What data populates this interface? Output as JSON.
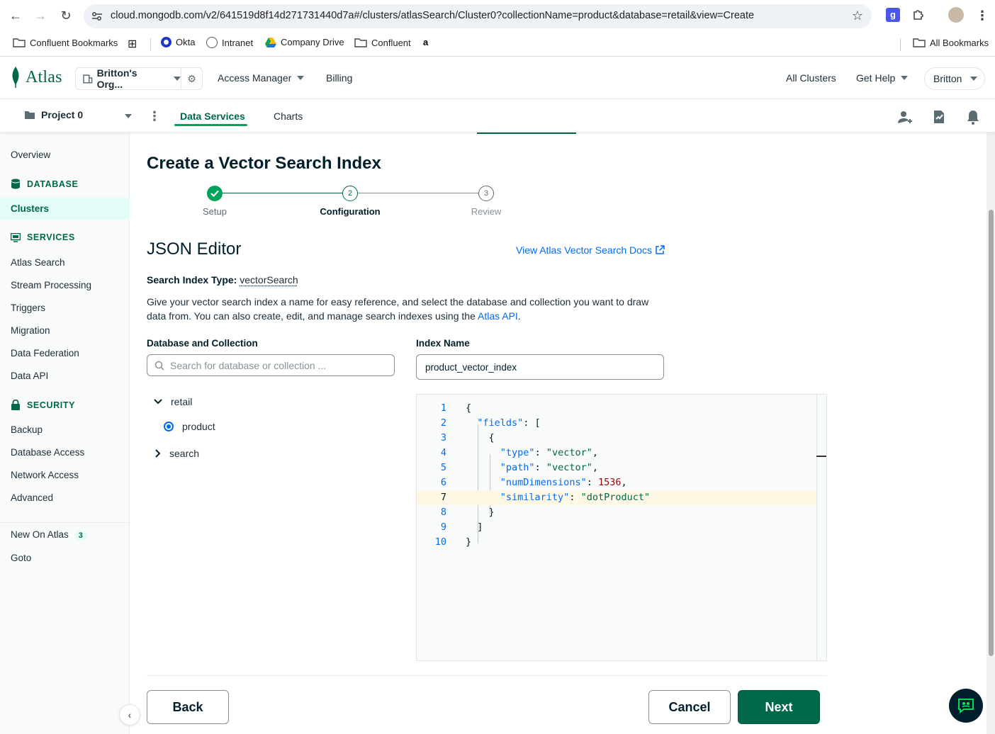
{
  "browser": {
    "url": "cloud.mongodb.com/v2/641519d8f14d271731440d7a#/clusters/atlasSearch/Cluster0?collectionName=product&database=retail&view=Create",
    "bookmarks": [
      "Confluent Bookmarks",
      "Okta",
      "Intranet",
      "Company Drive",
      "Confluent"
    ],
    "all_bookmarks": "All Bookmarks"
  },
  "header": {
    "logo": "Atlas",
    "org": "Britton's Org...",
    "access_manager": "Access Manager",
    "billing": "Billing",
    "all_clusters": "All Clusters",
    "get_help": "Get Help",
    "user": "Britton"
  },
  "project_bar": {
    "project": "Project 0",
    "tabs": [
      "Data Services",
      "Charts"
    ]
  },
  "sidebar": {
    "overview": "Overview",
    "database_section": "DATABASE",
    "clusters": "Clusters",
    "services_section": "SERVICES",
    "services": [
      "Atlas Search",
      "Stream Processing",
      "Triggers",
      "Migration",
      "Data Federation",
      "Data API"
    ],
    "security_section": "SECURITY",
    "security": [
      "Backup",
      "Database Access",
      "Network Access",
      "Advanced"
    ],
    "new_on_atlas": "New On Atlas",
    "new_count": "3",
    "goto": "Goto"
  },
  "main": {
    "title": "Create a Vector Search Index",
    "steps": [
      {
        "label": "Setup",
        "number": "1",
        "state": "done"
      },
      {
        "label": "Configuration",
        "number": "2",
        "state": "current"
      },
      {
        "label": "Review",
        "number": "3",
        "state": "todo"
      }
    ],
    "editor_heading": "JSON Editor",
    "docs_link": "View Atlas Vector Search Docs",
    "index_type_label": "Search Index Type:",
    "index_type_value": "vectorSearch",
    "description": "Give your vector search index a name for easy reference, and select the database and collection you want to draw data from. You can also create, edit, and manage search indexes using the ",
    "description_link": "Atlas API",
    "description_end": ".",
    "db_label": "Database and Collection",
    "db_placeholder": "Search for database or collection ...",
    "index_name_label": "Index Name",
    "index_name_value": "product_vector_index",
    "tree": {
      "db1": "retail",
      "collection": "product",
      "db2": "search"
    },
    "code_lines": [
      "1",
      "2",
      "3",
      "4",
      "5",
      "6",
      "7",
      "8",
      "9",
      "10"
    ],
    "json": {
      "fields_key": "\"fields\"",
      "type_key": "\"type\"",
      "type_val": "\"vector\"",
      "path_key": "\"path\"",
      "path_val": "\"vector\"",
      "dims_key": "\"numDimensions\"",
      "dims_val": "1536",
      "sim_key": "\"similarity\"",
      "sim_val": "\"dotProduct\""
    },
    "back": "Back",
    "cancel": "Cancel",
    "next": "Next"
  },
  "colors": {
    "brand": "#00684a",
    "link": "#016bf8",
    "accent": "#00a35c"
  }
}
